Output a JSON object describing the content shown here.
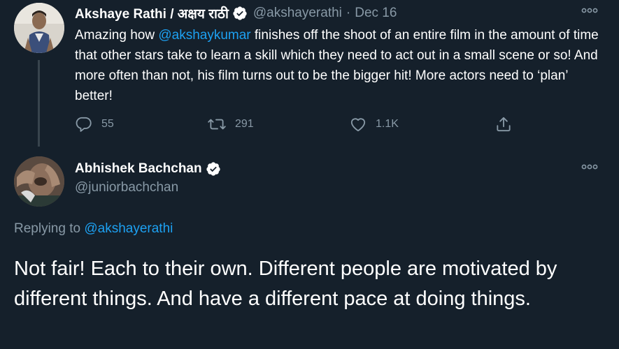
{
  "tweet1": {
    "author_name": "Akshaye Rathi / अक्षय राठी",
    "handle": "@akshayerathi",
    "separator": "·",
    "date": "Dec 16",
    "text_before": "Amazing how ",
    "mention": "@akshaykumar",
    "text_after": " finishes off the shoot of an entire film in the amount of time that other stars take to learn a skill which they need to act out in a small scene or so! And more often than not, his film turns out to be the bigger hit! More actors need to ‘plan’ better!",
    "reply_count": "55",
    "retweet_count": "291",
    "like_count": "1.1K",
    "icons": {
      "reply": "reply-icon",
      "retweet": "retweet-icon",
      "like": "heart-icon",
      "share": "share-icon",
      "more": "more-options-icon",
      "verified": "verified-badge-icon"
    }
  },
  "tweet2": {
    "author_name": "Abhishek Bachchan",
    "handle": "@juniorbachchan",
    "replying_label": "Replying to ",
    "replying_mention": "@akshayerathi",
    "text": "Not fair! Each to their own. Different people are motivated by different things. And have a different pace at doing things."
  },
  "colors": {
    "background": "#15202b",
    "text_primary": "#ffffff",
    "text_secondary": "#8899a6",
    "accent": "#1da1f2",
    "divider": "#38444d"
  }
}
